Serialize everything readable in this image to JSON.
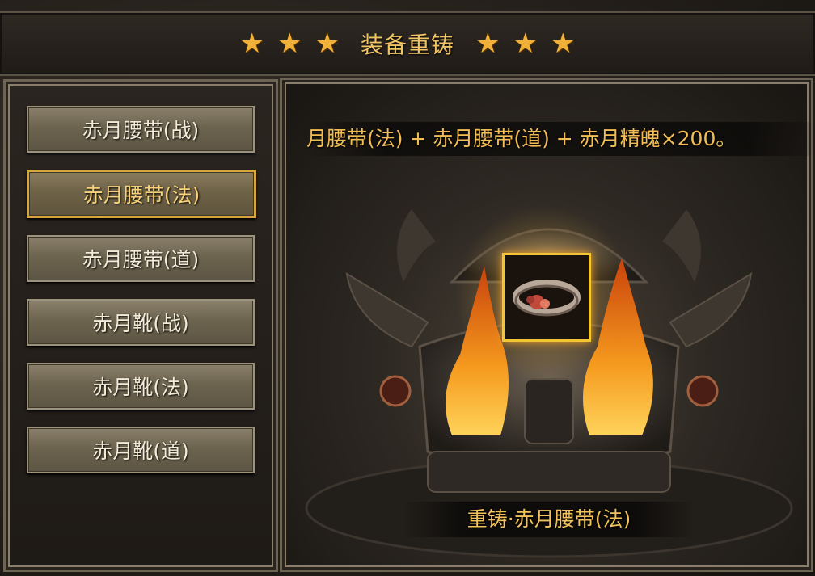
{
  "header": {
    "title": "装备重铸",
    "stars_left": [
      "★",
      "★",
      "★"
    ],
    "stars_right": [
      "★",
      "★",
      "★"
    ]
  },
  "equipment_list": [
    {
      "label": "赤月腰带(战)",
      "selected": false
    },
    {
      "label": "赤月腰带(法)",
      "selected": true
    },
    {
      "label": "赤月腰带(道)",
      "selected": false
    },
    {
      "label": "赤月靴(战)",
      "selected": false
    },
    {
      "label": "赤月靴(法)",
      "selected": false
    },
    {
      "label": "赤月靴(道)",
      "selected": false
    }
  ],
  "recast": {
    "recipe_text": "月腰带(法) + 赤月腰带(道) + 赤月精魄×200。",
    "result_text": "重铸·赤月腰带(法)",
    "item_icon": "belt-icon"
  },
  "colors": {
    "title_gold": "#f1c466",
    "selected_border": "#d6a73a",
    "flame": "#f08a1a"
  }
}
